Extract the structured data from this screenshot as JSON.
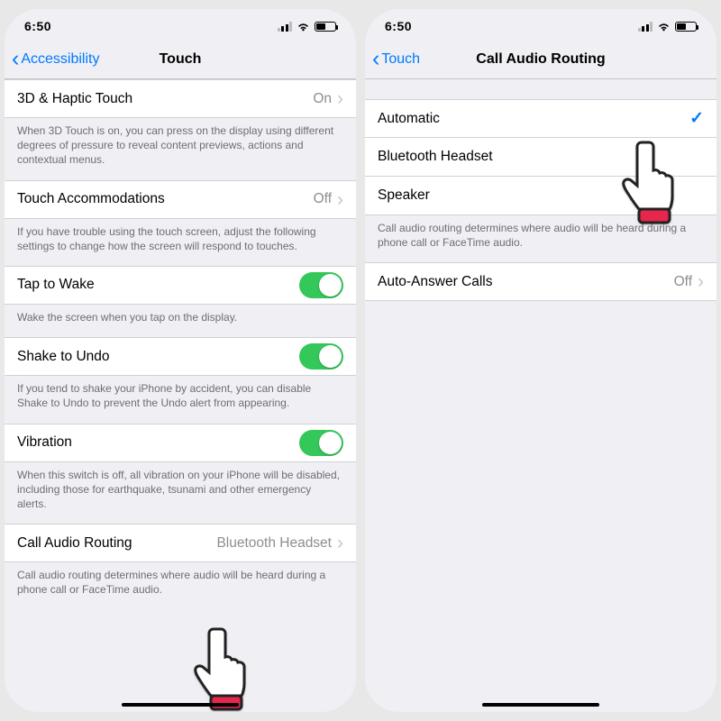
{
  "left": {
    "status_time": "6:50",
    "nav_back": "Accessibility",
    "nav_title": "Touch",
    "rows": {
      "haptic_label": "3D & Haptic Touch",
      "haptic_value": "On",
      "haptic_footer": "When 3D Touch is on, you can press on the display using different degrees of pressure to reveal content previews, actions and contextual menus.",
      "accom_label": "Touch Accommodations",
      "accom_value": "Off",
      "accom_footer": "If you have trouble using the touch screen, adjust the following settings to change how the screen will respond to touches.",
      "tap_label": "Tap to Wake",
      "tap_footer": "Wake the screen when you tap on the display.",
      "shake_label": "Shake to Undo",
      "shake_footer": "If you tend to shake your iPhone by accident, you can disable Shake to Undo to prevent the Undo alert from appearing.",
      "vib_label": "Vibration",
      "vib_footer": "When this switch is off, all vibration on your iPhone will be disabled, including those for earthquake, tsunami and other emergency alerts.",
      "car_label": "Call Audio Routing",
      "car_value": "Bluetooth Headset",
      "car_footer": "Call audio routing determines where audio will be heard during a phone call or FaceTime audio."
    }
  },
  "right": {
    "status_time": "6:50",
    "nav_back": "Touch",
    "nav_title": "Call Audio Routing",
    "options": {
      "auto": "Automatic",
      "bt": "Bluetooth Headset",
      "spk": "Speaker"
    },
    "options_footer": "Call audio routing determines where audio will be heard during a phone call or FaceTime audio.",
    "auto_answer_label": "Auto-Answer Calls",
    "auto_answer_value": "Off"
  }
}
